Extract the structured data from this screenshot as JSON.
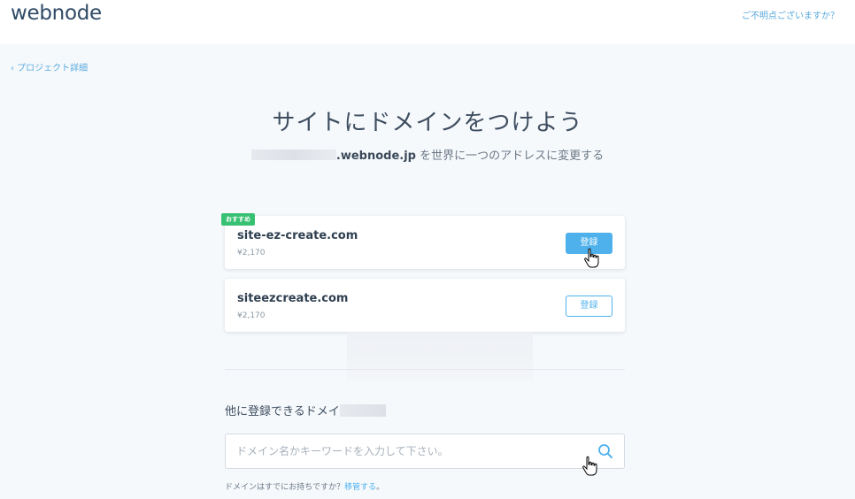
{
  "header": {
    "logo": "webnode",
    "help_link": "ご不明点ございますか？"
  },
  "nav": {
    "back_link": "‹ プロジェクト詳細"
  },
  "hero": {
    "title": "サイトにドメインをつけよう",
    "subtitle_domain": ".webnode.jp",
    "subtitle_rest": " を世界に一つのアドレスに変更する"
  },
  "suggestions": [
    {
      "badge": "おすすめ",
      "domain": "site-ez-create.com",
      "price": "¥2,170",
      "button": "登録",
      "button_style": "primary"
    },
    {
      "domain": "siteezcreate.com",
      "price": "¥2,170",
      "button": "登録",
      "button_style": "outline"
    }
  ],
  "other": {
    "label": "他に登録できるドメイ",
    "search_placeholder": "ドメイン名かキーワードを入力して下さい。"
  },
  "footer": {
    "note": "ドメインはすでにお持ちですか？",
    "transfer_link": "移管する",
    "note_end": "。"
  },
  "colors": {
    "accent": "#4eb1ec",
    "badge": "#38c172",
    "background": "#f6f9fc"
  },
  "icons": {
    "search": "search-icon",
    "cursor": "hand-pointer-icon"
  }
}
